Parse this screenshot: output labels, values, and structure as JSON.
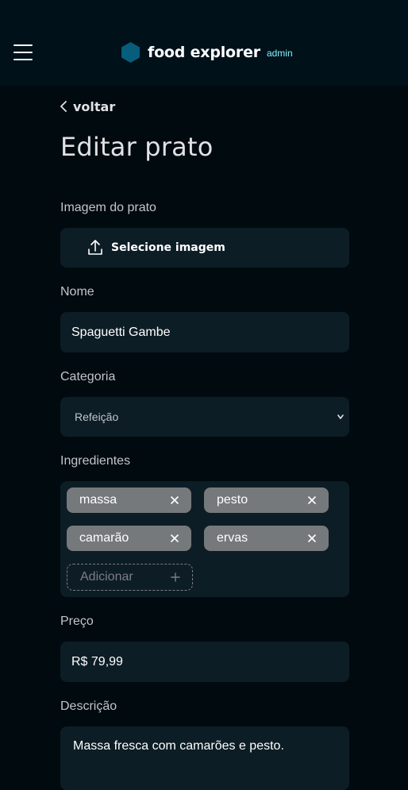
{
  "header": {
    "brand_name": "food explorer",
    "brand_role": "admin",
    "logo_color": "#065e7c",
    "background": "#00111a"
  },
  "back_label": "voltar",
  "page_title": "Editar prato",
  "form": {
    "image_label": "Imagem do prato",
    "image_button": "Selecione imagem",
    "name_label": "Nome",
    "name_value": "Spaguetti Gambe",
    "category_label": "Categoria",
    "category_value": "Refeição",
    "ingredients_label": "Ingredientes",
    "ingredients": [
      "massa",
      "pesto",
      "camarão",
      "ervas"
    ],
    "ingredient_placeholder": "Adicionar",
    "price_label": "Preço",
    "price_value": "R$ 79,99",
    "description_label": "Descrição",
    "description_value": "Massa fresca com camarões e pesto."
  },
  "icons": {
    "menu": "hamburger-menu-icon",
    "logo": "hexagon-logo-icon",
    "back": "chevron-left-icon",
    "upload": "upload-icon",
    "select": "chevron-down-icon",
    "remove": "close-icon",
    "add": "plus-icon"
  },
  "colors": {
    "page_background": "#000a0f",
    "field_background": "#0d1d25",
    "tag_background": "#76797b",
    "accent": "#82f3ff"
  }
}
